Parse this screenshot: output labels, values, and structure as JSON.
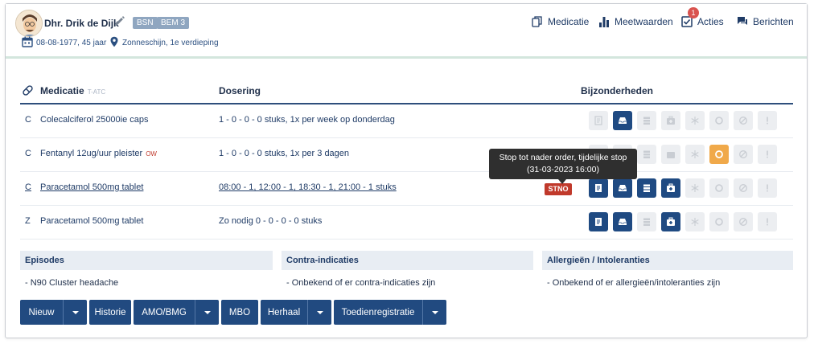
{
  "patient": {
    "name": "Dhr. Drik de Dijk",
    "tags": [
      "BSN",
      "BEM 3"
    ],
    "dob": "08-08-1977, 45 jaar",
    "location": "Zonneschijn, 1e verdieping"
  },
  "nav": {
    "medicatie": "Medicatie",
    "meetwaarden": "Meetwaarden",
    "acties": "Acties",
    "acties_badge": "1",
    "berichten": "Berichten"
  },
  "table": {
    "headers": {
      "medicatie": "Medicatie",
      "medicatie_sub": "T-ATC",
      "dosering": "Dosering",
      "bijzonderheden": "Bijzonderheden"
    },
    "rows": [
      {
        "code": "C",
        "name": "Colecalciferol 25000ie caps",
        "flag": "",
        "dosering": "1 - 0 - 0 - 0 stuks, 1x per week op donderdag",
        "status": ""
      },
      {
        "code": "C",
        "name": "Fentanyl 12ug/uur pleister",
        "flag": "OW",
        "dosering": "1 - 0 - 0 - 0 stuks, 1x per 3 dagen",
        "status": ""
      },
      {
        "code": "C",
        "name": "Paracetamol 500mg tablet",
        "flag": "",
        "dosering": "08:00 - 1, 12:00 - 1, 18:30 - 1, 21:00 - 1 stuks",
        "status": "STNO"
      },
      {
        "code": "Z",
        "name": "Paracetamol 500mg tablet",
        "flag": "",
        "dosering": "Zo nodig 0 - 0 - 0 - 0 stuks",
        "status": ""
      }
    ],
    "tooltip_line1": "Stop tot nader order, tijdelijke stop",
    "tooltip_line2": "(31-03-2023 16:00)"
  },
  "panels": {
    "episodes": {
      "title": "Episodes",
      "text": "- N90 Cluster headache"
    },
    "contra": {
      "title": "Contra-indicaties",
      "text": "- Onbekend of er contra-indicaties zijn"
    },
    "allergie": {
      "title": "Allergieën / Intoleranties",
      "text": "- Onbekend of er allergieën/intoleranties zijn"
    }
  },
  "buttons": {
    "nieuw": "Nieuw",
    "historie": "Historie",
    "amo": "AMO/BMG",
    "mbo": "MBO",
    "herhaal": "Herhaal",
    "toedien": "Toedienregistratie"
  },
  "colors": {
    "primary": "#214a80",
    "danger": "#c0392b",
    "warning": "#f0a94a"
  }
}
